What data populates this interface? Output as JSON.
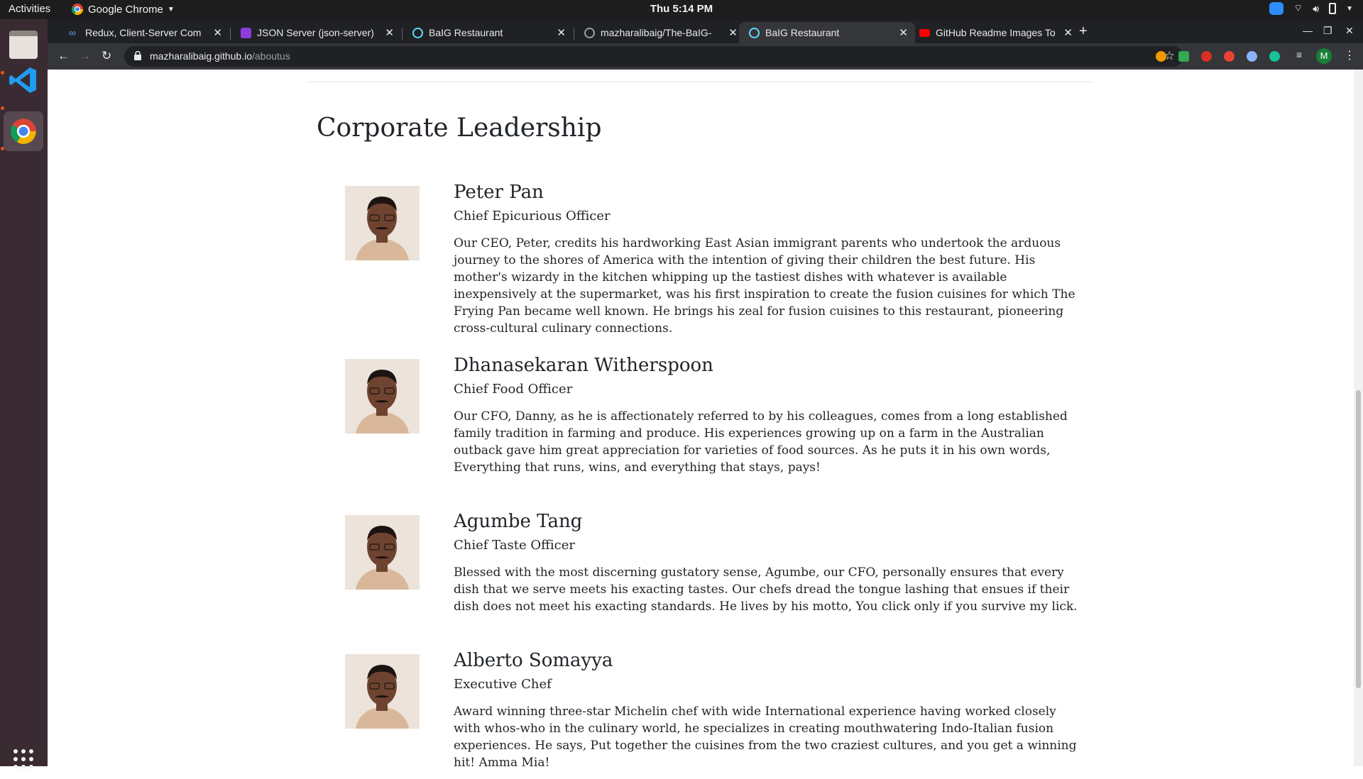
{
  "topbar": {
    "activities": "Activities",
    "app_name": "Google Chrome",
    "clock": "Thu  5:14 PM"
  },
  "tabs": [
    {
      "title": "Redux, Client-Server Com",
      "favicon": "coursera-icon"
    },
    {
      "title": "JSON Server (json-server)",
      "favicon": "json-server-icon"
    },
    {
      "title": "BaIG Restaurant",
      "favicon": "react-icon"
    },
    {
      "title": "mazharalibaig/The-BaIG-",
      "favicon": "github-icon"
    },
    {
      "title": "BaIG Restaurant",
      "favicon": "react-icon",
      "active": true
    },
    {
      "title": "GitHub Readme Images To",
      "favicon": "youtube-icon"
    }
  ],
  "toolbar": {
    "url_host": "mazharalibaig.github.io",
    "url_path": "/aboutus",
    "profile_initial": "M"
  },
  "page": {
    "section_title": "Corporate Leadership",
    "leaders": [
      {
        "name": "Peter Pan",
        "role": "Chief Epicurious Officer",
        "bio": "Our CEO, Peter, credits his hardworking East Asian immigrant parents who undertook the arduous journey to the shores of America with the intention of giving their children the best future. His mother's wizardy in the kitchen whipping up the tastiest dishes with whatever is available inexpensively at the supermarket, was his first inspiration to create the fusion cuisines for which The Frying Pan became well known. He brings his zeal for fusion cuisines to this restaurant, pioneering cross-cultural culinary connections."
      },
      {
        "name": "Dhanasekaran Witherspoon",
        "role": "Chief Food Officer",
        "bio": "Our CFO, Danny, as he is affectionately referred to by his colleagues, comes from a long established family tradition in farming and produce. His experiences growing up on a farm in the Australian outback gave him great appreciation for varieties of food sources. As he puts it in his own words, Everything that runs, wins, and everything that stays, pays!"
      },
      {
        "name": "Agumbe Tang",
        "role": "Chief Taste Officer",
        "bio": "Blessed with the most discerning gustatory sense, Agumbe, our CFO, personally ensures that every dish that we serve meets his exacting tastes. Our chefs dread the tongue lashing that ensues if their dish does not meet his exacting standards. He lives by his motto, You click only if you survive my lick."
      },
      {
        "name": "Alberto Somayya",
        "role": "Executive Chef",
        "bio": "Award winning three-star Michelin chef with wide International experience having worked closely with whos-who in the culinary world, he specializes in creating mouthwatering Indo-Italian fusion experiences. He says, Put together the cuisines from the two craziest cultures, and you get a winning hit! Amma Mia!"
      }
    ]
  }
}
